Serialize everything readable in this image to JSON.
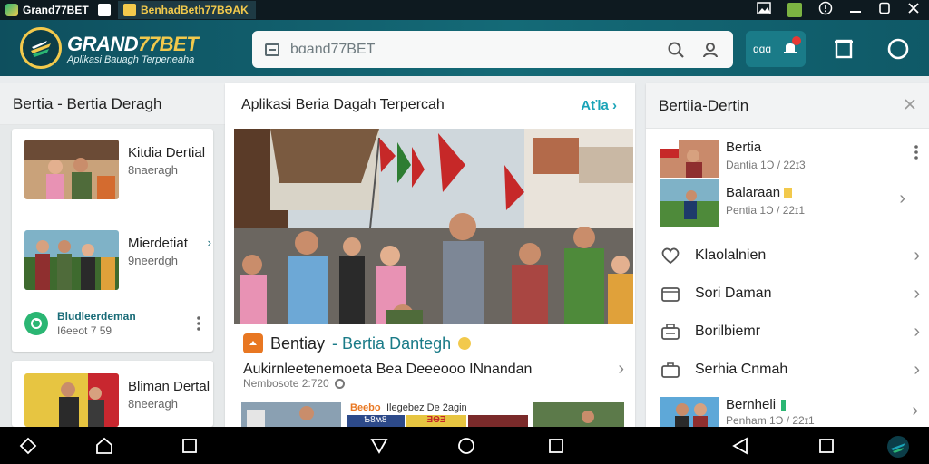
{
  "status_bar": {
    "tabs": [
      {
        "label": "Grand77BET"
      },
      {
        "label": "BenhadBeth77BƏAK"
      }
    ],
    "icons": [
      "image-icon",
      "tab-icon",
      "info-icon",
      "minimize-icon",
      "maximize-icon",
      "close-icon"
    ]
  },
  "header": {
    "logo_main": "GRAND",
    "logo_accent": "77BET",
    "logo_sub": "Aplikasi Bauagh Terpeneaha",
    "search_placeholder": "bɑand77BET",
    "actions_label": "ɑɑɑ"
  },
  "left_panel": {
    "title": "Bertia - Bertia Deragh",
    "items": [
      {
        "title": "Kitdia Dertial",
        "subtitle": "8naeragh"
      },
      {
        "title": "Mierdetiat",
        "subtitle": "9neerdgh"
      },
      {
        "title": "Bludleerdeman",
        "subtitle": "I6eeot 7 59"
      },
      {
        "title": "Bliman Dertal",
        "subtitle": "8neeragh"
      }
    ]
  },
  "center_panel": {
    "title": "Aplikasi Beria Dagah Terpercah",
    "action_label": "Aťla",
    "post_author": "Bentiay",
    "post_title_rest": "- Bertia Dantegh",
    "post_text": "Aukirnleetenemoeta Bea Deeeooo INnandan",
    "post_meta": "Nembosote 2:720",
    "bottom_tag": "Beebo",
    "bottom_text": "Ilegebez De 2agin",
    "bottom_badges": [
      "Ƅ8ʍ8",
      "ƎƟƎ"
    ]
  },
  "right_panel": {
    "title": "Bertiia-Dertin",
    "featured": [
      {
        "title": "Bertia",
        "subtitle": "Dantia 1Ɔ / 22ɪ3"
      },
      {
        "title": "Balaraan",
        "subtitle": "Pentia 1Ɔ / 22ɪ1"
      }
    ],
    "list": [
      {
        "label": "Klaolalnien",
        "icon": "heart-icon"
      },
      {
        "label": "Sori Daman",
        "icon": "folder-icon"
      },
      {
        "label": "Borilbiemr",
        "icon": "briefcase-icon"
      },
      {
        "label": "Serhia Cnmah",
        "icon": "bag-icon"
      }
    ],
    "last": {
      "title": "Bernheli",
      "subtitle": "Penham 1Ɔ / 22ɪ1"
    }
  },
  "colors": {
    "header_bg": "#146a77",
    "accent_gold": "#f2c94c",
    "accent_teal": "#1aa4b8",
    "badge_red": "#e53935"
  }
}
